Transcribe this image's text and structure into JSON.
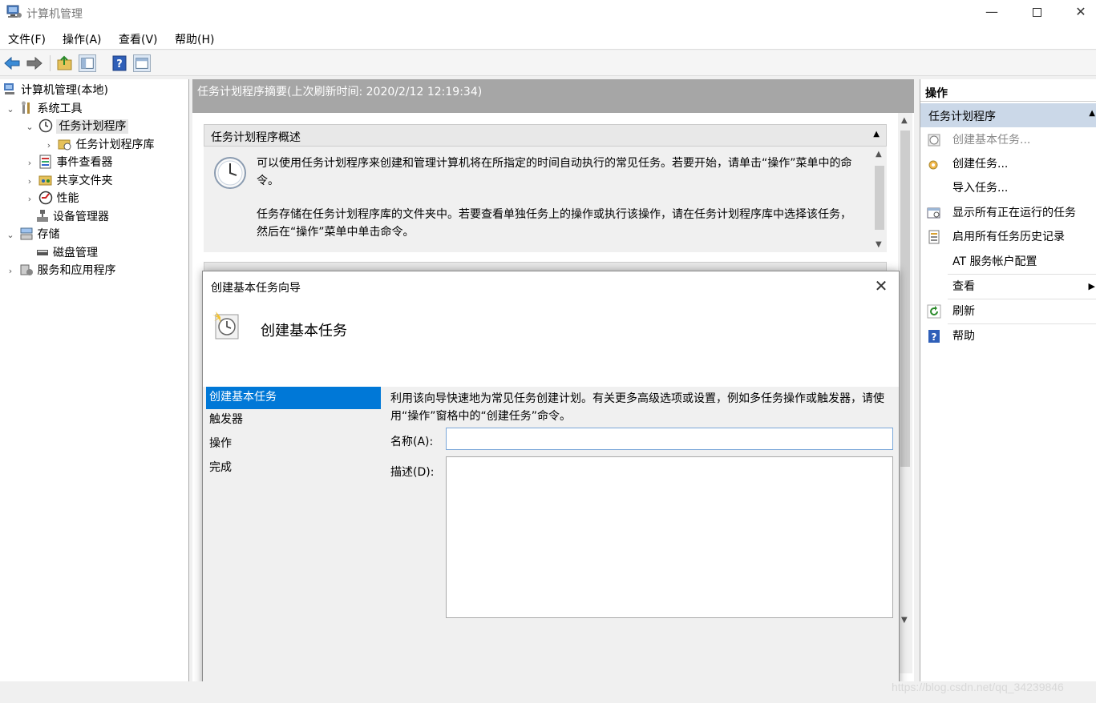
{
  "window": {
    "title": "计算机管理",
    "minimize": "—",
    "close": "✕"
  },
  "menu": [
    "文件(F)",
    "操作(A)",
    "查看(V)",
    "帮助(H)"
  ],
  "toolbar": {
    "icons": [
      "back-icon",
      "forward-icon",
      "up-folder-icon",
      "show-hide-tree-icon",
      "help-icon",
      "show-hide-action-pane-icon"
    ]
  },
  "tree": {
    "root": "计算机管理(本地)",
    "system_tools": "系统工具",
    "task_scheduler": "任务计划程序",
    "task_scheduler_library": "任务计划程序库",
    "event_viewer": "事件查看器",
    "shared_folders": "共享文件夹",
    "performance": "性能",
    "device_manager": "设备管理器",
    "storage": "存储",
    "disk_management": "磁盘管理",
    "services_apps": "服务和应用程序"
  },
  "center": {
    "header": "任务计划程序摘要(上次刷新时间: 2020/2/12 12:19:34)",
    "section_title": "任务计划程序概述",
    "para1": "可以使用任务计划程序来创建和管理计算机将在所指定的时间自动执行的常见任务。若要开始，请单击“操作”菜单中的命令。",
    "para2": "任务存储在任务计划程序库的文件夹中。若要查看单独任务上的操作或执行该操作，请在任务计划程序库中选择该任务，然后在“操作”菜单中单击命令。"
  },
  "actions": {
    "title": "操作",
    "section": "任务计划程序",
    "items": [
      {
        "label": "创建基本任务...",
        "disabled": true
      },
      {
        "label": "创建任务..."
      },
      {
        "label": "导入任务..."
      },
      {
        "label": "显示所有正在运行的任务"
      },
      {
        "label": "启用所有任务历史记录"
      },
      {
        "label": "AT 服务帐户配置"
      },
      {
        "label": "查看"
      },
      {
        "label": "刷新"
      },
      {
        "label": "帮助"
      }
    ]
  },
  "dialog": {
    "title": "创建基本任务向导",
    "heading": "创建基本任务",
    "steps": [
      "创建基本任务",
      "触发器",
      "操作",
      "完成"
    ],
    "description": "利用该向导快速地为常见任务创建计划。有关更多高级选项或设置，例如多任务操作或触发器，请使用“操作”窗格中的“创建任务”命令。",
    "name_label": "名称(A):",
    "name_value": "",
    "desc_label": "描述(D):",
    "desc_value": ""
  },
  "watermark": "https://blog.csdn.net/qq_34239846",
  "colors": {
    "selection": "#0078d7",
    "action_section": "#cbd8e8",
    "center_header": "#a6a6a6"
  }
}
